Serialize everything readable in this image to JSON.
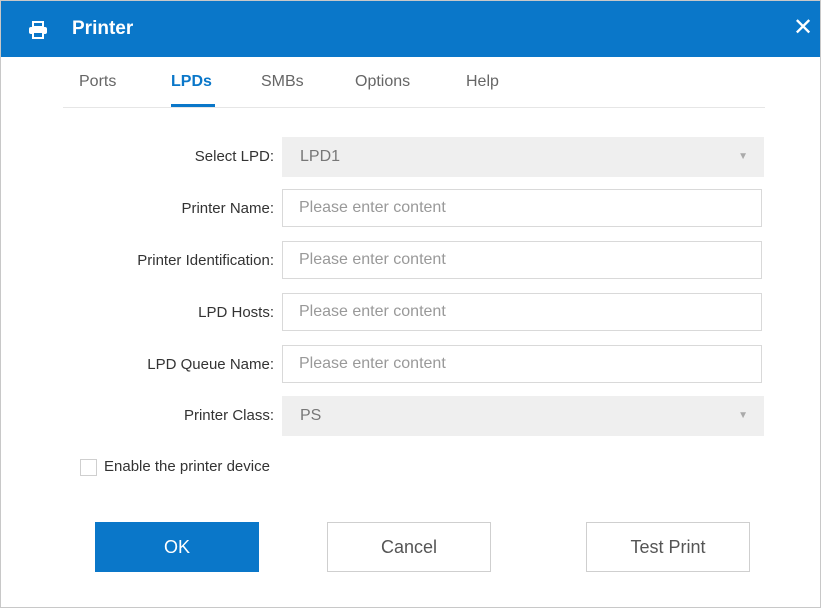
{
  "window": {
    "title": "Printer",
    "close_glyph": "✕",
    "icon": "printer-icon",
    "accent_color": "#0a77c9"
  },
  "tabs": [
    {
      "label": "Ports",
      "active": false
    },
    {
      "label": "LPDs",
      "active": true
    },
    {
      "label": "SMBs",
      "active": false
    },
    {
      "label": "Options",
      "active": false
    },
    {
      "label": "Help",
      "active": false
    }
  ],
  "form": {
    "select_lpd": {
      "label": "Select LPD:",
      "value": "LPD1"
    },
    "printer_name": {
      "label": "Printer Name:",
      "value": "",
      "placeholder": "Please enter content"
    },
    "printer_identification": {
      "label": "Printer Identification:",
      "value": "",
      "placeholder": "Please enter content"
    },
    "lpd_hosts": {
      "label": "LPD Hosts:",
      "value": "",
      "placeholder": "Please enter content"
    },
    "lpd_queue_name": {
      "label": "LPD Queue Name:",
      "value": "",
      "placeholder": "Please enter content"
    },
    "printer_class": {
      "label": "Printer Class:",
      "value": "PS"
    },
    "enable_device": {
      "label": "Enable the printer device",
      "checked": false
    }
  },
  "buttons": {
    "ok": "OK",
    "cancel": "Cancel",
    "test_print": "Test Print"
  }
}
